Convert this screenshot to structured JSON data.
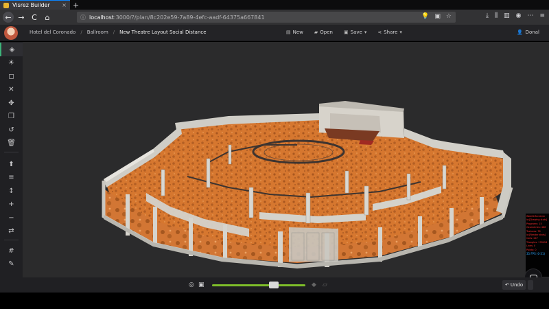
{
  "browser": {
    "tab_title": "Visrez Builder",
    "tab_close": "×",
    "new_tab": "+",
    "url_host": "localhost",
    "url_path": ":3000/?/plan/8c202e59-7a89-4efc-aadf-64375a667841",
    "back_icon": "←",
    "forward_icon": "→",
    "reload_icon": "C",
    "home_icon": "⌂",
    "url_right_icons": [
      "💡",
      "▣",
      "☆"
    ],
    "nav_right_icons": [
      "⤓",
      "⫼",
      "▥",
      "◉",
      "⋯",
      "≡"
    ]
  },
  "header": {
    "breadcrumbs": [
      "Hotel del Coronado",
      "Ballroom",
      "New Theatre Layout Social Distance"
    ],
    "breadcrumb_sep": "/",
    "actions": {
      "new": "New",
      "open": "Open",
      "save": "Save",
      "share": "Share"
    },
    "user": "Donal"
  },
  "sidebar_icons": [
    "cube-icon",
    "lightbulb-icon",
    "select-frame-icon",
    "close-icon",
    "move-icon",
    "copy-icon",
    "undo-rotate-icon",
    "trash-icon",
    "align-top-icon",
    "align-middle-icon",
    "vertical-arrows-icon",
    "plus-icon",
    "minus-icon",
    "swap-icon",
    "grid-icon",
    "edit-icon"
  ],
  "sidebar_glyphs": [
    "◈",
    "☀",
    "◻",
    "✕",
    "✥",
    "❐",
    "↺",
    "🗑",
    "⬆",
    "≡",
    "↕",
    "+",
    "−",
    "⇄",
    "#",
    "✎"
  ],
  "debug": {
    "lines": [
      "WebGLRenderer",
      "io:[Drawing stats]",
      "Programs: 15",
      "Geometries: 488",
      "Textures: 76",
      "io:[Render stats]",
      "Calls: 247",
      "Triangles: 176494",
      "Lines: 0",
      "Points: 0"
    ],
    "fps": "35 FPS (0-31)"
  },
  "bottom": {
    "zoom_level": 0.66,
    "undo": "Undo",
    "redo": "",
    "undo_icon": "↶",
    "target_icon": "◎",
    "fit_icon": "▣",
    "tag_icon": "◆",
    "ruler_icon": "▱"
  },
  "colors": {
    "accent_green": "#3db37a",
    "slider_green": "#7fbf2a",
    "carpet": "#d8782e",
    "wall": "#c9c8c3"
  }
}
